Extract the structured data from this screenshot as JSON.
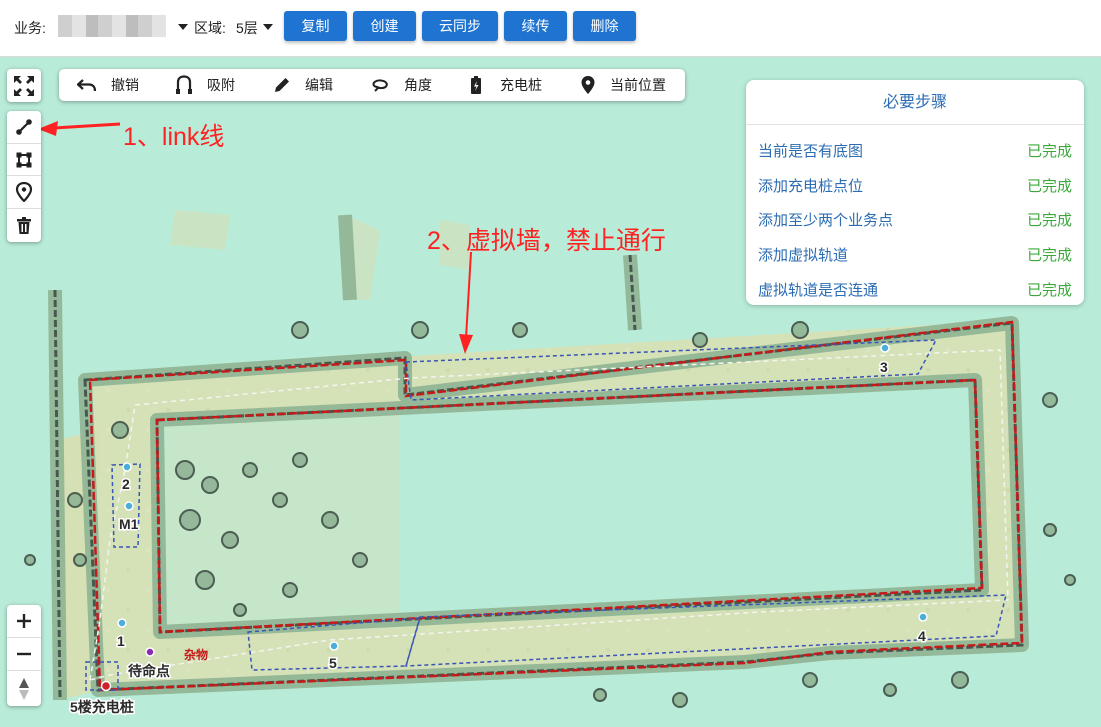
{
  "topbar": {
    "business_label": "业务:",
    "region_label": "区域:",
    "region_value": "5层",
    "buttons": [
      "复制",
      "创建",
      "云同步",
      "续传",
      "删除"
    ]
  },
  "toolbar": {
    "undo": "撤销",
    "snap": "吸附",
    "edit": "编辑",
    "angle": "角度",
    "charger": "充电桩",
    "current_position": "当前位置"
  },
  "left_controls": {
    "top": [
      "fullscreen-icon"
    ],
    "draw": [
      "link-line-icon",
      "polygon-icon",
      "marker-icon",
      "trash-icon"
    ],
    "zoom": [
      "zoom-in-icon",
      "zoom-out-icon",
      "compass-icon"
    ]
  },
  "steps_panel": {
    "title": "必要步骤",
    "items": [
      {
        "label": "当前是否有底图",
        "status": "已完成"
      },
      {
        "label": "添加充电桩点位",
        "status": "已完成"
      },
      {
        "label": "添加至少两个业务点",
        "status": "已完成"
      },
      {
        "label": "添加虚拟轨道",
        "status": "已完成"
      },
      {
        "label": "虚拟轨道是否连通",
        "status": "已完成"
      }
    ]
  },
  "annotations": {
    "link_line": "1、link线",
    "virtual_wall": "2、虚拟墙，禁止通行"
  },
  "map_labels": {
    "p1": "1",
    "p2": "2",
    "p3": "3",
    "p4": "4",
    "p5": "5",
    "m1": "M1",
    "standby": "待命点",
    "sundries": "杂物",
    "charger": "5楼充电桩"
  },
  "colors": {
    "primary_button": "#1f74d2",
    "map_background": "#b8ecd8",
    "virtual_wall": "#c41a1a",
    "step_link": "#2b6cb3",
    "step_done": "#3ca83c",
    "annotation": "#ff2222"
  }
}
